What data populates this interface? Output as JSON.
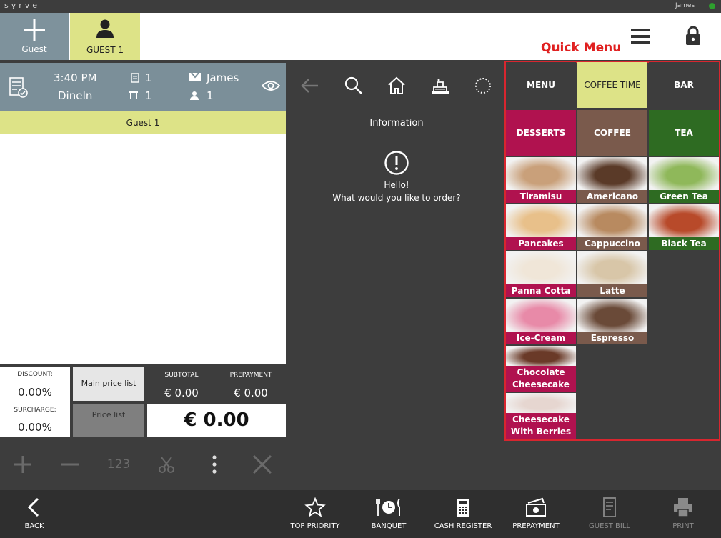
{
  "app": {
    "brand": "syrve",
    "user": "James",
    "status_color": "#2ea02e"
  },
  "header": {
    "guest_button_label": "Guest",
    "guest_tab_label": "GUEST 1",
    "quick_menu_title": "Quick Menu"
  },
  "order": {
    "time": "3:40 PM",
    "order_type": "DineIn",
    "orders_count": "1",
    "table_count": "1",
    "waiter": "James",
    "guests_count": "1",
    "guest_row": "Guest 1"
  },
  "totals": {
    "discount_label": "DISCOUNT:",
    "discount_value": "0.00%",
    "surcharge_label": "SURCHARGE:",
    "surcharge_value": "0.00%",
    "main_price_list": "Main price list",
    "price_list": "Price list",
    "subtotal_label": "SUBTOTAL",
    "subtotal_value": "€ 0.00",
    "prepayment_label": "PREPAYMENT",
    "prepayment_value": "€ 0.00",
    "total_value": "€ 0.00"
  },
  "toolbar": {
    "quantity_label": "123"
  },
  "info": {
    "title": "Information",
    "hello": "Hello!",
    "question": "What would you like to order?"
  },
  "quick_menu": {
    "tabs": [
      {
        "label": "MENU",
        "color": "#3d3d3d"
      },
      {
        "label": "COFFEE TIME",
        "color": "#dde387"
      },
      {
        "label": "BAR",
        "color": "#3d3d3d"
      }
    ],
    "categories": [
      {
        "label": "DESSERTS",
        "color": "#b0124f"
      },
      {
        "label": "COFFEE",
        "color": "#7a5a4c"
      },
      {
        "label": "TEA",
        "color": "#2e6b22"
      }
    ],
    "items": [
      {
        "name": "Tiramisu",
        "color": "#b0124f"
      },
      {
        "name": "Americano",
        "color": "#7a5a4c"
      },
      {
        "name": "Green Tea",
        "color": "#2e6b22"
      },
      {
        "name": "Pancakes",
        "color": "#b0124f"
      },
      {
        "name": "Cappuccino",
        "color": "#7a5a4c"
      },
      {
        "name": "Black Tea",
        "color": "#2e6b22"
      },
      {
        "name": "Panna Cotta",
        "color": "#b0124f"
      },
      {
        "name": "Latte",
        "color": "#7a5a4c"
      },
      {
        "name": "Ice-Cream",
        "color": "#b0124f"
      },
      {
        "name": "Espresso",
        "color": "#7a5a4c"
      },
      {
        "name": "Chocolate Cheesecake",
        "color": "#b0124f"
      },
      {
        "name": "Cheesecake With Berries",
        "color": "#b0124f"
      }
    ]
  },
  "bottom_bar": {
    "back": "BACK",
    "top_priority": "TOP PRIORITY",
    "banquet": "BANQUET",
    "cash_register": "CASH REGISTER",
    "prepayment": "PREPAYMENT",
    "guest_bill": "GUEST BILL",
    "print": "PRINT"
  }
}
